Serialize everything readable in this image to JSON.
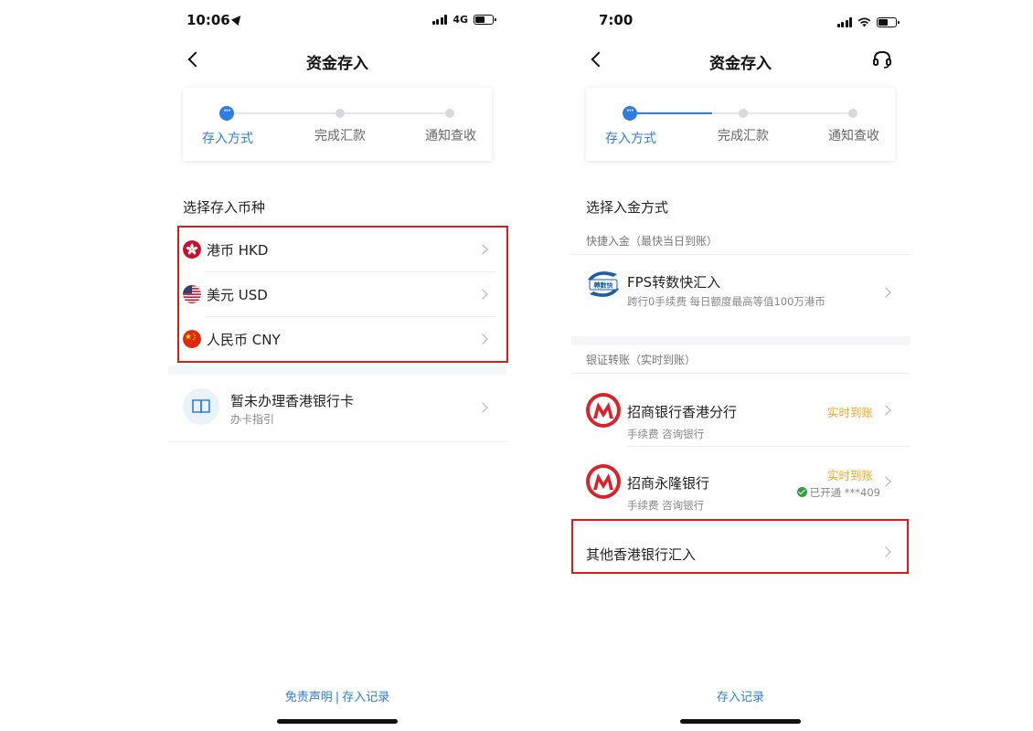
{
  "left": {
    "status": {
      "time": "10:06",
      "network": "4G"
    },
    "nav": {
      "title": "资金存入"
    },
    "steps": [
      "存入方式",
      "完成汇款",
      "通知查收"
    ],
    "section_title": "选择存入币种",
    "currencies": [
      {
        "label": "港币 HKD",
        "flag": "hk-flag-icon"
      },
      {
        "label": "美元 USD",
        "flag": "us-flag-icon"
      },
      {
        "label": "人民币 CNY",
        "flag": "cn-flag-icon"
      }
    ],
    "card_help": {
      "title": "暂未办理香港银行卡",
      "subtitle": "办卡指引"
    },
    "footer": {
      "disclaimer": "免责声明",
      "separator": "|",
      "records": "存入记录"
    }
  },
  "right": {
    "status": {
      "time": "7:00"
    },
    "nav": {
      "title": "资金存入",
      "service_icon": "headset-icon"
    },
    "steps": [
      "存入方式",
      "完成汇款",
      "通知查收"
    ],
    "section_title": "选择入金方式",
    "quick_header": "快捷入金（最快当日到账）",
    "fps": {
      "title": "FPS转数快汇入",
      "subtitle": "跨行0手续费 每日额度最高等值100万港币"
    },
    "bank_header": "银证转账（实时到账）",
    "banks": [
      {
        "title": "招商银行香港分行",
        "subtitle": "手续费 咨询银行",
        "tag": "实时到账",
        "opened": ""
      },
      {
        "title": "招商永隆银行",
        "subtitle": "手续费 咨询银行",
        "tag": "实时到账",
        "opened": "已开通 ***409"
      }
    ],
    "other_bank": "其他香港银行汇入",
    "footer": {
      "records": "存入记录"
    }
  },
  "colors": {
    "accent": "#2e7de1",
    "highlight": "#e01919",
    "realtime": "#f5a623",
    "cmb_red": "#d8232a"
  }
}
